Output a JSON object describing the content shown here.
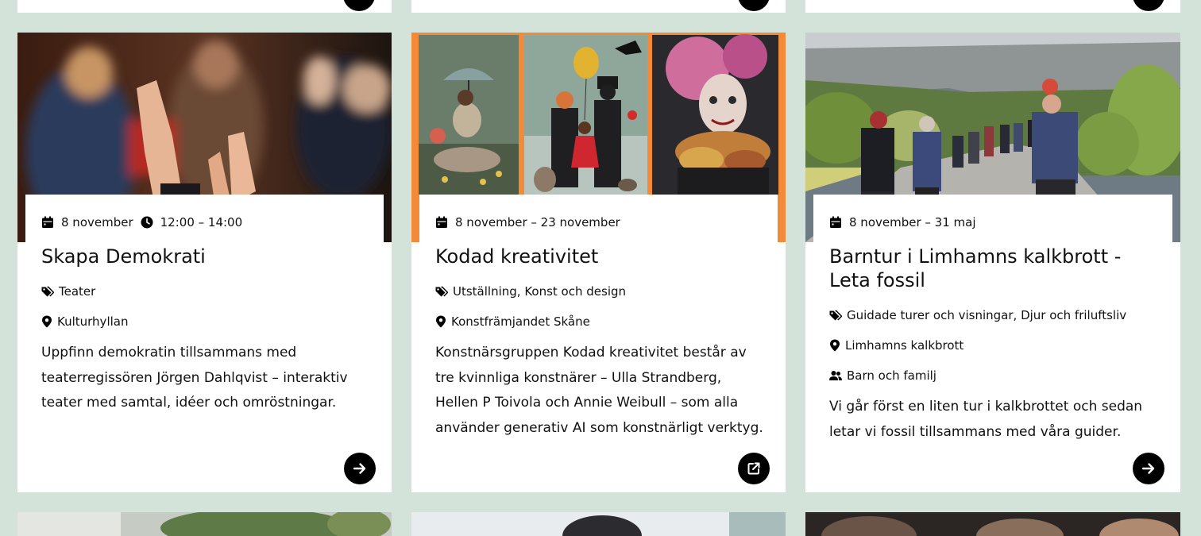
{
  "cards": [
    {
      "date": "8 november",
      "time": "12:00 – 14:00",
      "title": "Skapa Demokrati",
      "category": "Teater",
      "location": "Kulturhyllan",
      "description": "Uppfinn demokratin tillsammans med teaterregissören Jörgen Dahlqvist – interaktiv teater med samtal, idéer och omröstningar.",
      "button_icon": "arrow-right-icon"
    },
    {
      "date": "8 november – 23 november",
      "title": "Kodad kreativitet",
      "category": "Utställning, Konst och design",
      "location": "Konstfrämjandet Skåne",
      "description": "Konstnärsgruppen Kodad kreativitet består av tre kvinnliga konstnärer – Ulla Strandberg, Hellen P Toivola och Annie Weibull – som alla använder generativ AI som konstnärligt verktyg.",
      "button_icon": "external-link-icon",
      "accent": "#f28a37"
    },
    {
      "date": "8 november – 31 maj",
      "title": "Barntur i Limhamns kalkbrott - Leta fossil",
      "category": "Guidade turer och visningar, Djur och friluftsliv",
      "location": "Limhamns kalkbrott",
      "audience": "Barn och familj",
      "description": "Vi går först en liten tur i kalkbrottet och sedan letar vi fossil tillsammans med våra guider.",
      "button_icon": "arrow-right-icon"
    }
  ],
  "colors": {
    "page_bg": "#d3e3da",
    "card_bg": "#ffffff",
    "button_bg": "#000000"
  }
}
